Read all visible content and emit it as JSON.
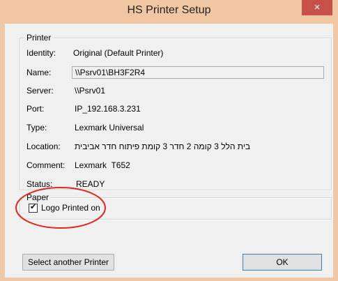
{
  "window": {
    "title": "HS Printer Setup",
    "close": "×"
  },
  "printer_group": {
    "legend": "Printer",
    "identity_label": "Identity:",
    "identity_value": "Original (Default Printer)",
    "name_label": "Name:",
    "name_value": "\\\\Psrv01\\BH3F2R4",
    "server_label": "Server:",
    "server_value": "\\\\Psrv01",
    "port_label": "Port:",
    "port_value": "IP_192.168.3.231",
    "type_label": "Type:",
    "type_value": "Lexmark Universal",
    "location_label": "Location:",
    "location_value": "בית הלל 3 קומה 2 חדר 3 קומת פיתוח חדר אביבית",
    "comment_label": "Comment:",
    "comment_value": "Lexmark  T652",
    "status_label": "Status:",
    "status_value": "READY"
  },
  "paper_group": {
    "legend": "Paper",
    "logo_checkbox_label": "Logo Printed on",
    "logo_checked": true,
    "check_glyph": "✔"
  },
  "buttons": {
    "select_another": "Select another Printer",
    "ok": "OK"
  },
  "colors": {
    "title_bar": "#f1c6a3",
    "close_button": "#c7504a",
    "annotation_circle": "#e0271f"
  }
}
